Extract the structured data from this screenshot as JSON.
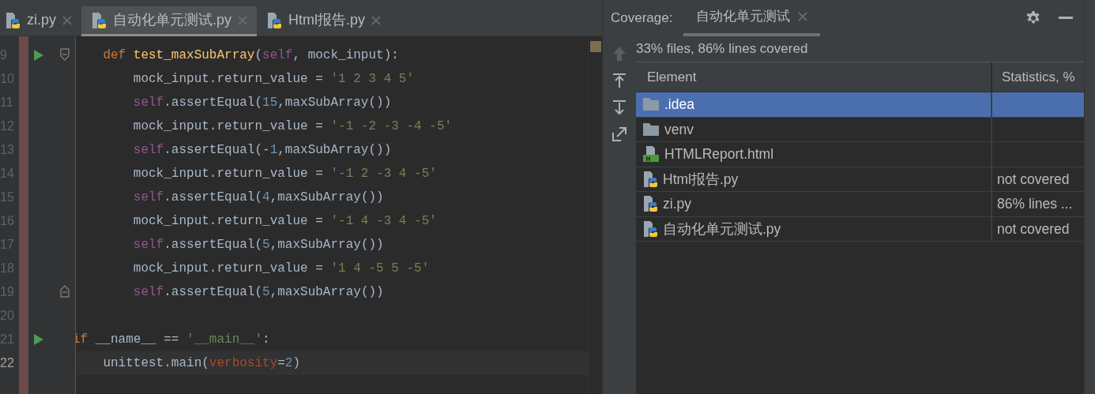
{
  "editor_tabs": [
    {
      "label": "zi.py",
      "selected": false
    },
    {
      "label": "自动化单元测试.py",
      "selected": true
    },
    {
      "label": "Html报告.py",
      "selected": false
    }
  ],
  "code_lines": [
    {
      "number": "9",
      "run_marker": true,
      "fold_start": true,
      "fold_end": false,
      "current": false,
      "tokens": [
        {
          "text": "    def ",
          "kind": "keyword"
        },
        {
          "text": "test_maxSubArray",
          "kind": "function"
        },
        {
          "text": "(",
          "kind": "plain"
        },
        {
          "text": "self",
          "kind": "self"
        },
        {
          "text": ", mock_input):",
          "kind": "plain"
        }
      ]
    },
    {
      "number": "10",
      "run_marker": false,
      "fold_start": false,
      "fold_end": false,
      "current": false,
      "tokens": [
        {
          "text": "        mock_input.return_value = ",
          "kind": "plain"
        },
        {
          "text": "'1 2 3 4 5'",
          "kind": "string"
        }
      ]
    },
    {
      "number": "11",
      "run_marker": false,
      "fold_start": false,
      "fold_end": false,
      "current": false,
      "tokens": [
        {
          "text": "        self",
          "kind": "self"
        },
        {
          "text": ".assertEqual(",
          "kind": "plain"
        },
        {
          "text": "15",
          "kind": "number"
        },
        {
          "text": ",maxSubArray())",
          "kind": "plain"
        }
      ]
    },
    {
      "number": "12",
      "run_marker": false,
      "fold_start": false,
      "fold_end": false,
      "current": false,
      "tokens": [
        {
          "text": "        mock_input.return_value = ",
          "kind": "plain"
        },
        {
          "text": "'-1 -2 -3 -4 -5'",
          "kind": "string"
        }
      ]
    },
    {
      "number": "13",
      "run_marker": false,
      "fold_start": false,
      "fold_end": false,
      "current": false,
      "tokens": [
        {
          "text": "        self",
          "kind": "self"
        },
        {
          "text": ".assertEqual(-",
          "kind": "plain"
        },
        {
          "text": "1",
          "kind": "number"
        },
        {
          "text": ",maxSubArray())",
          "kind": "plain"
        }
      ]
    },
    {
      "number": "14",
      "run_marker": false,
      "fold_start": false,
      "fold_end": false,
      "current": false,
      "tokens": [
        {
          "text": "        mock_input.return_value = ",
          "kind": "plain"
        },
        {
          "text": "'-1 2 -3 4 -5'",
          "kind": "string"
        }
      ]
    },
    {
      "number": "15",
      "run_marker": false,
      "fold_start": false,
      "fold_end": false,
      "current": false,
      "tokens": [
        {
          "text": "        self",
          "kind": "self"
        },
        {
          "text": ".assertEqual(",
          "kind": "plain"
        },
        {
          "text": "4",
          "kind": "number"
        },
        {
          "text": ",maxSubArray())",
          "kind": "plain"
        }
      ]
    },
    {
      "number": "16",
      "run_marker": false,
      "fold_start": false,
      "fold_end": false,
      "current": false,
      "tokens": [
        {
          "text": "        mock_input.return_value = ",
          "kind": "plain"
        },
        {
          "text": "'-1 4 -3 4 -5'",
          "kind": "string"
        }
      ]
    },
    {
      "number": "17",
      "run_marker": false,
      "fold_start": false,
      "fold_end": false,
      "current": false,
      "tokens": [
        {
          "text": "        self",
          "kind": "self"
        },
        {
          "text": ".assertEqual(",
          "kind": "plain"
        },
        {
          "text": "5",
          "kind": "number"
        },
        {
          "text": ",maxSubArray())",
          "kind": "plain"
        }
      ]
    },
    {
      "number": "18",
      "run_marker": false,
      "fold_start": false,
      "fold_end": false,
      "current": false,
      "tokens": [
        {
          "text": "        mock_input.return_value = ",
          "kind": "plain"
        },
        {
          "text": "'1 4 -5 5 -5'",
          "kind": "string"
        }
      ]
    },
    {
      "number": "19",
      "run_marker": false,
      "fold_start": false,
      "fold_end": true,
      "current": false,
      "tokens": [
        {
          "text": "        self",
          "kind": "self"
        },
        {
          "text": ".assertEqual(",
          "kind": "plain"
        },
        {
          "text": "5",
          "kind": "number"
        },
        {
          "text": ",maxSubArray())",
          "kind": "plain"
        }
      ]
    },
    {
      "number": "20",
      "run_marker": false,
      "fold_start": false,
      "fold_end": false,
      "current": false
    },
    {
      "number": "21",
      "run_marker": true,
      "fold_start": false,
      "fold_end": false,
      "current": false,
      "tokens": [
        {
          "text": "if ",
          "kind": "keyword"
        },
        {
          "text": "__name__ == ",
          "kind": "plain"
        },
        {
          "text": "'__main__'",
          "kind": "string"
        },
        {
          "text": ":",
          "kind": "plain"
        }
      ]
    },
    {
      "number": "22",
      "run_marker": false,
      "fold_start": false,
      "fold_end": false,
      "current": true,
      "tokens": [
        {
          "text": "    unittest.main(",
          "kind": "plain"
        },
        {
          "text": "verbosity",
          "kind": "param"
        },
        {
          "text": "=",
          "kind": "plain"
        },
        {
          "text": "2",
          "kind": "number"
        },
        {
          "text": ")",
          "kind": "plain"
        }
      ]
    }
  ],
  "coverage": {
    "title": "Coverage:",
    "tab": {
      "label": "自动化单元测试",
      "selected": true
    },
    "summary": "33% files, 86% lines covered",
    "columns": [
      "Element",
      "Statistics, %"
    ],
    "rows": [
      {
        "kind": "folder",
        "name": ".idea",
        "selected": true
      },
      {
        "kind": "folder",
        "name": "venv",
        "selected": false
      },
      {
        "kind": "html",
        "name": "HTMLReport.html",
        "selected": false
      },
      {
        "kind": "python",
        "name": "Html报告.py",
        "statistics": "not covered",
        "selected": false
      },
      {
        "kind": "python",
        "name": "zi.py",
        "statistics": "86% lines ...",
        "selected": false
      },
      {
        "kind": "python",
        "name": "自动化单元测试.py",
        "statistics": "not covered",
        "selected": false
      }
    ]
  }
}
